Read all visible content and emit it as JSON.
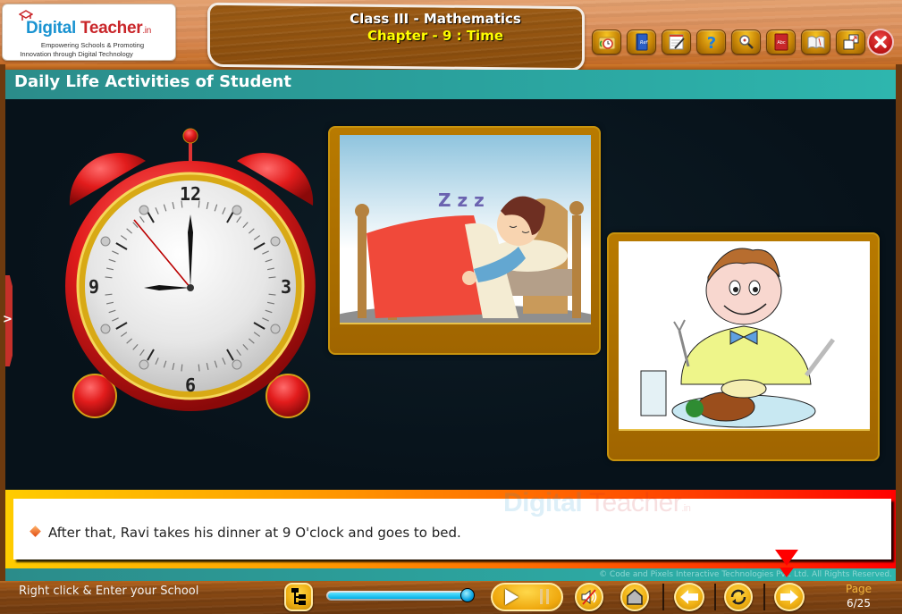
{
  "logo": {
    "brand_part1": "Digital",
    "brand_part2": "Teacher",
    "brand_suffix": ".in",
    "tagline_line1": "Empowering Schools & Promoting",
    "tagline_line2": "Innovation through Digital Technology"
  },
  "header": {
    "class_title": "Class III - Mathematics",
    "chapter_title": "Chapter - 9 : Time"
  },
  "toolbar": {
    "items": [
      {
        "name": "activity",
        "icon": "clock-folder-icon"
      },
      {
        "name": "reference",
        "icon": "ref-book-icon"
      },
      {
        "name": "notes",
        "icon": "notepad-pencil-icon"
      },
      {
        "name": "help",
        "icon": "question-mark-icon"
      },
      {
        "name": "search",
        "icon": "magnifier-icon"
      },
      {
        "name": "dictionary",
        "icon": "abc-book-icon"
      },
      {
        "name": "glossary",
        "icon": "open-book-icon"
      },
      {
        "name": "window",
        "icon": "restore-window-icon"
      }
    ],
    "close": {
      "icon": "close-icon"
    }
  },
  "section": {
    "title": "Daily Life Activities of Student"
  },
  "stage": {
    "clock": {
      "numerals": [
        "12",
        "3",
        "6",
        "9"
      ],
      "time_shown": "9:00"
    },
    "images": [
      {
        "name": "boy-sleeping-image",
        "description": "Boy sleeping in bed",
        "zzz": "Z z z"
      },
      {
        "name": "boy-eating-dinner-image",
        "description": "Boy eating dinner"
      }
    ],
    "side_tab_glyph": ">"
  },
  "narration": {
    "text": "After that, Ravi takes his dinner at 9 O'clock and goes to bed.",
    "watermark_part1": "Digital",
    "watermark_part2": "Teacher",
    "watermark_suffix": ".in"
  },
  "footer": {
    "copyright": "© Code and Pixels Interactive Technologies  Pvt. Ltd. All Rights Reserved.",
    "school_prompt": "Right click & Enter your School",
    "progress": 1.0,
    "page_label": "Page",
    "page_current": 6,
    "page_total": 25,
    "page_display": "6/25"
  },
  "colors": {
    "section_header": "#2aa19d",
    "title_yellow": "#ffff00",
    "narration_gradient_start": "#ffcc00",
    "narration_gradient_end": "#ff0000",
    "progress_fill": "#00aee6",
    "page_label": "#f0b43c"
  }
}
